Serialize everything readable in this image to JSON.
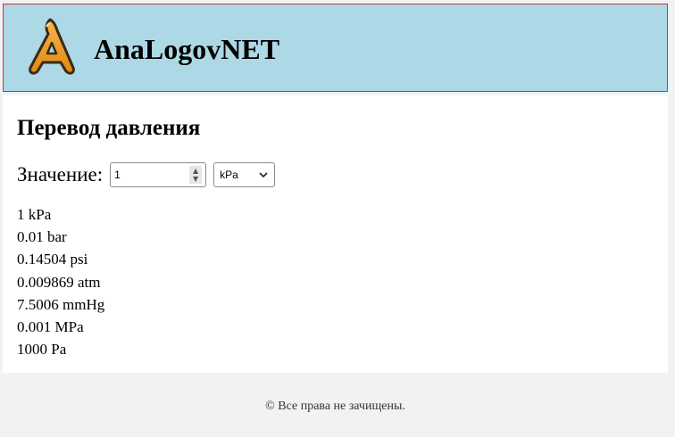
{
  "header": {
    "logo_icon": "letter-a-logo-icon",
    "site_title": "AnaLogovNET",
    "background_color": "#add8e6",
    "border_color": "#c0392b"
  },
  "main": {
    "heading": "Перевод давления",
    "value_label": "Значение:",
    "value_input": "1",
    "unit_select": {
      "selected": "kPa",
      "icon": "chevron-down-icon"
    },
    "spinner_icons": [
      "chevron-up-icon",
      "chevron-down-icon"
    ],
    "results": [
      "1 kPa",
      "0.01 bar",
      "0.14504 psi",
      "0.009869 atm",
      "7.5006 mmHg",
      "0.001 MPa",
      "1000 Pa"
    ]
  },
  "footer": {
    "text": "© Все права не зачищены.",
    "background_color": "#f2f2f2"
  }
}
